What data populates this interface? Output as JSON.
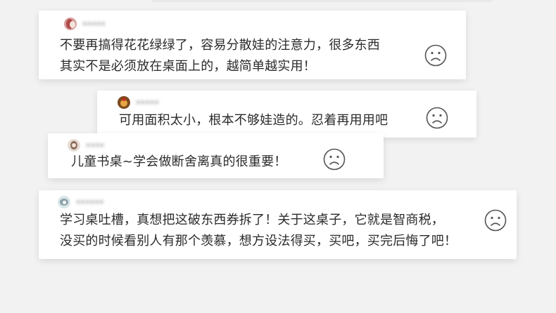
{
  "background_color": "#f2f2f2",
  "reviews": [
    {
      "username": "▪▪▪▪▪",
      "lines": [
        "不要再搞得花花绿绿了，容易分散娃的注意力，很多东西",
        "其实不是必须放在桌面上的，越简单越实用！"
      ],
      "face_icon": "sad-face-icon"
    },
    {
      "username": "▪▪▪▪▪",
      "lines": [
        "可用面积太小，根本不够娃造的。忍着再用用吧"
      ],
      "face_icon": "sad-face-icon"
    },
    {
      "username": "▪▪▪▪",
      "lines": [
        "儿童书桌~学会做断舍离真的很重要！"
      ],
      "face_icon": "sad-face-icon"
    },
    {
      "username": "▪▪▪▪▪▪",
      "lines": [
        "学习桌吐槽，真想把这破东西券拆了！关于这桌子，它就是智商税，",
        "没买的时候看别人有那个羡慕，想方设法得买，买吧，买完后悔了吧！"
      ],
      "face_icon": "sad-face-icon"
    }
  ]
}
